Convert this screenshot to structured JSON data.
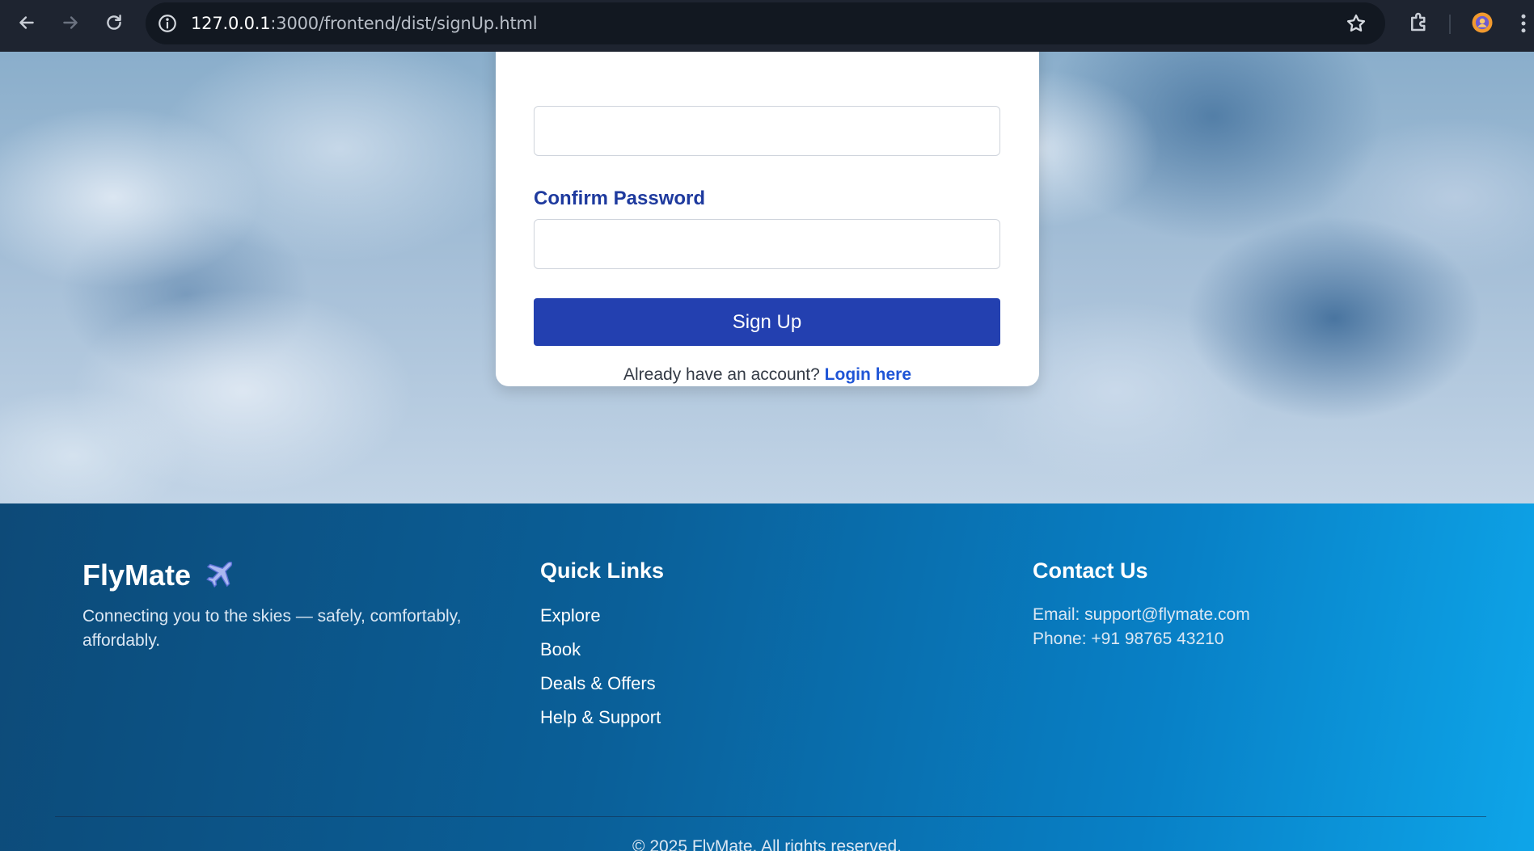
{
  "browser": {
    "url_host": "127.0.0.1",
    "url_path": ":3000/frontend/dist/signUp.html",
    "icons": [
      "back-icon",
      "forward-icon",
      "reload-icon",
      "info-icon",
      "star-icon",
      "extensions-icon",
      "profile-icon",
      "menu-icon"
    ]
  },
  "form": {
    "confirm_password_label": "Confirm Password",
    "signup_button": "Sign Up",
    "login_prompt": "Already have an account?",
    "login_link": "Login here"
  },
  "footer": {
    "brand": "FlyMate",
    "tagline": "Connecting you to the skies — safely, comfortably, affordably.",
    "quick_links_title": "Quick Links",
    "quick_links": [
      "Explore",
      "Book",
      "Deals & Offers",
      "Help & Support"
    ],
    "contact_title": "Contact Us",
    "email": "Email: support@flymate.com",
    "phone": "Phone: +91 98765 43210",
    "copyright": "© 2025 FlyMate. All rights reserved."
  },
  "colors": {
    "primary_button": "#2340b0",
    "label": "#1e3a9e",
    "link": "#1f55d6",
    "footer_start": "#0d4a78",
    "footer_end": "#0ea5e9"
  }
}
